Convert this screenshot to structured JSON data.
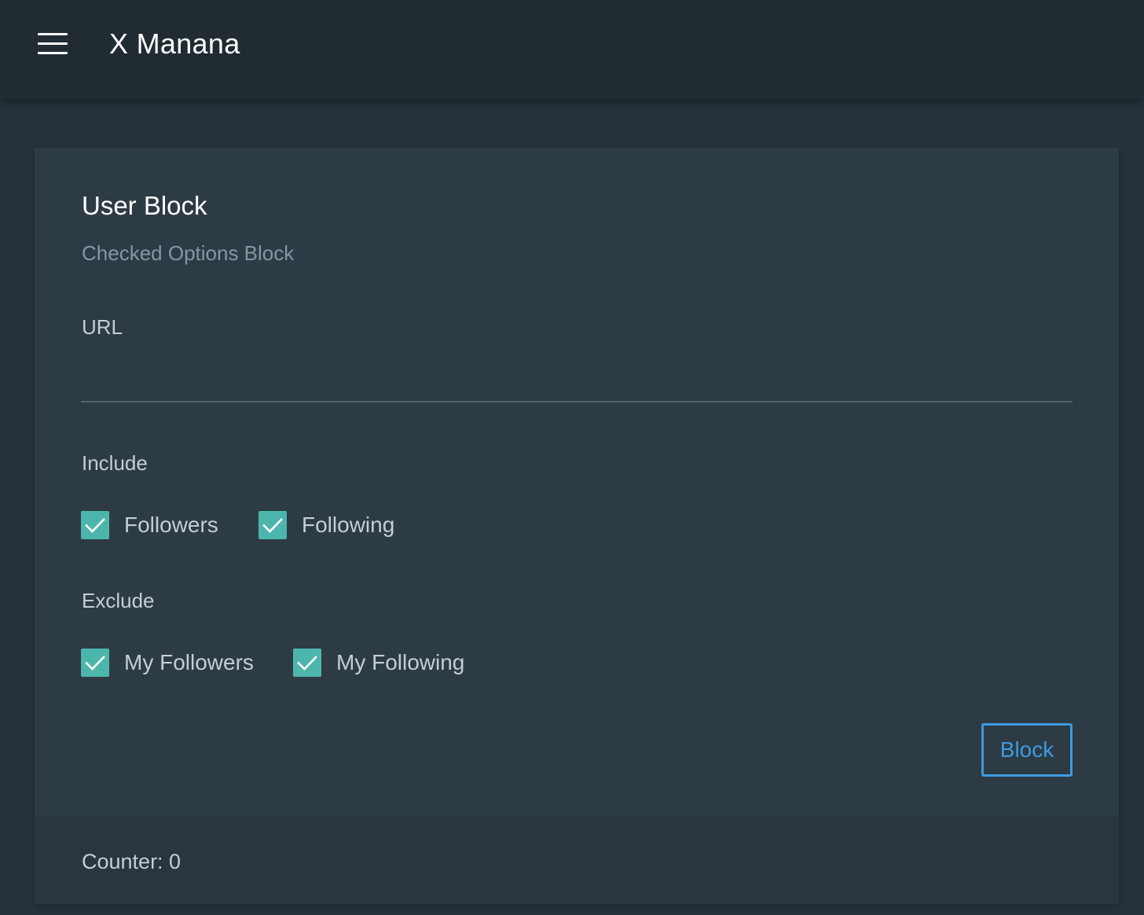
{
  "app": {
    "title": "X Manana",
    "menu_icon": "hamburger-menu-icon"
  },
  "card": {
    "title": "User Block",
    "subtitle": "Checked Options Block",
    "url_field": {
      "label": "URL",
      "value": "",
      "placeholder": ""
    },
    "include": {
      "label": "Include",
      "options": [
        {
          "label": "Followers",
          "checked": true
        },
        {
          "label": "Following",
          "checked": true
        }
      ]
    },
    "exclude": {
      "label": "Exclude",
      "options": [
        {
          "label": "My Followers",
          "checked": true
        },
        {
          "label": "My Following",
          "checked": true
        }
      ]
    },
    "block_button_label": "Block",
    "counter_text": "Counter: 0"
  },
  "colors": {
    "background": "#25323a",
    "appbar": "#212b32",
    "card": "#2d3b45",
    "checkbox": "#4db6ac",
    "button_accent": "#3d9be0"
  }
}
